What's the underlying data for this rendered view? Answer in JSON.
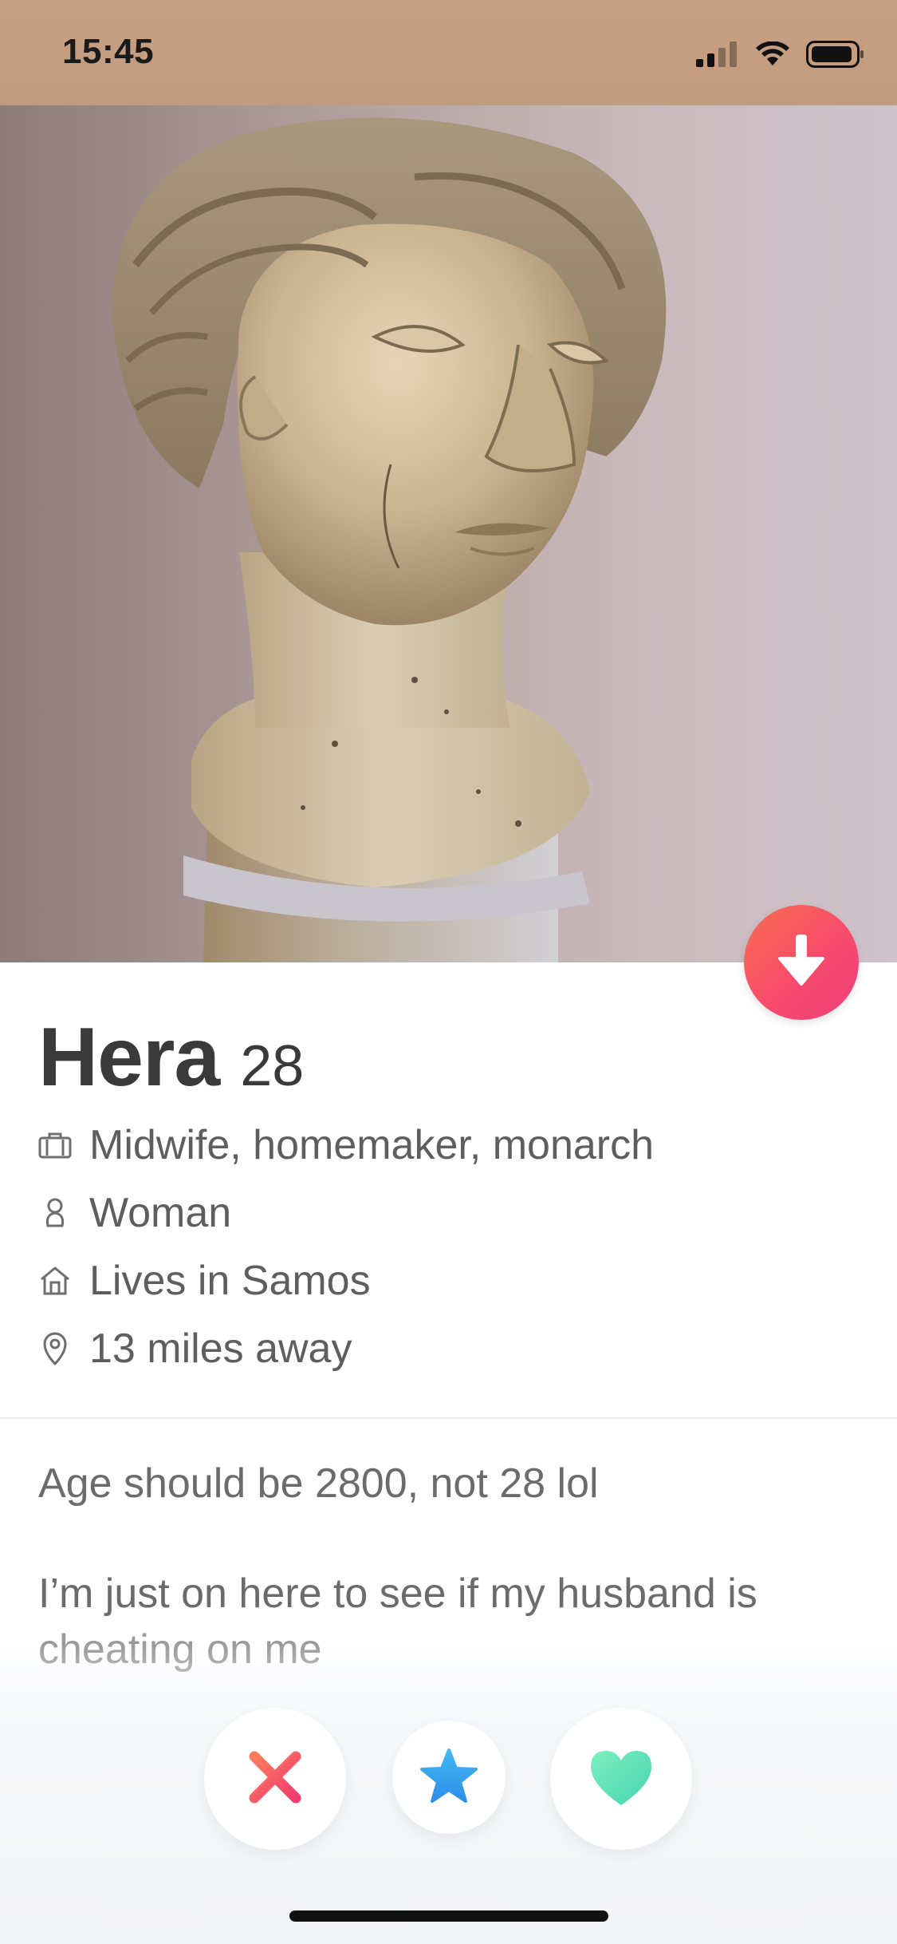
{
  "status_bar": {
    "time": "15:45",
    "icons": [
      "cellular-signal-icon",
      "wifi-icon",
      "battery-icon"
    ]
  },
  "photo": {
    "subject": "marble-bust-photo"
  },
  "profile": {
    "name": "Hera",
    "age": "28",
    "details": [
      {
        "icon": "briefcase-icon",
        "text": "Midwife, homemaker, monarch"
      },
      {
        "icon": "gender-icon",
        "text": "Woman"
      },
      {
        "icon": "home-icon",
        "text": "Lives in Samos"
      },
      {
        "icon": "location-pin-icon",
        "text": "13 miles away"
      }
    ],
    "bio_line1": "Age should be 2800, not 28 lol",
    "bio_line2": "I’m just on here to see if my husband is",
    "bio_line3": "cheating on me"
  },
  "actions": {
    "nope_icon": "close-icon",
    "super_like_icon": "star-icon",
    "like_icon": "heart-icon"
  },
  "colors": {
    "status_bar_bg": "#c29a7d",
    "accent_gradient_start": "#fb6f4f",
    "accent_gradient_end": "#ee3f7c",
    "nope": "#f2556d",
    "super_like": "#3da4f0",
    "like": "#5be0b6"
  }
}
